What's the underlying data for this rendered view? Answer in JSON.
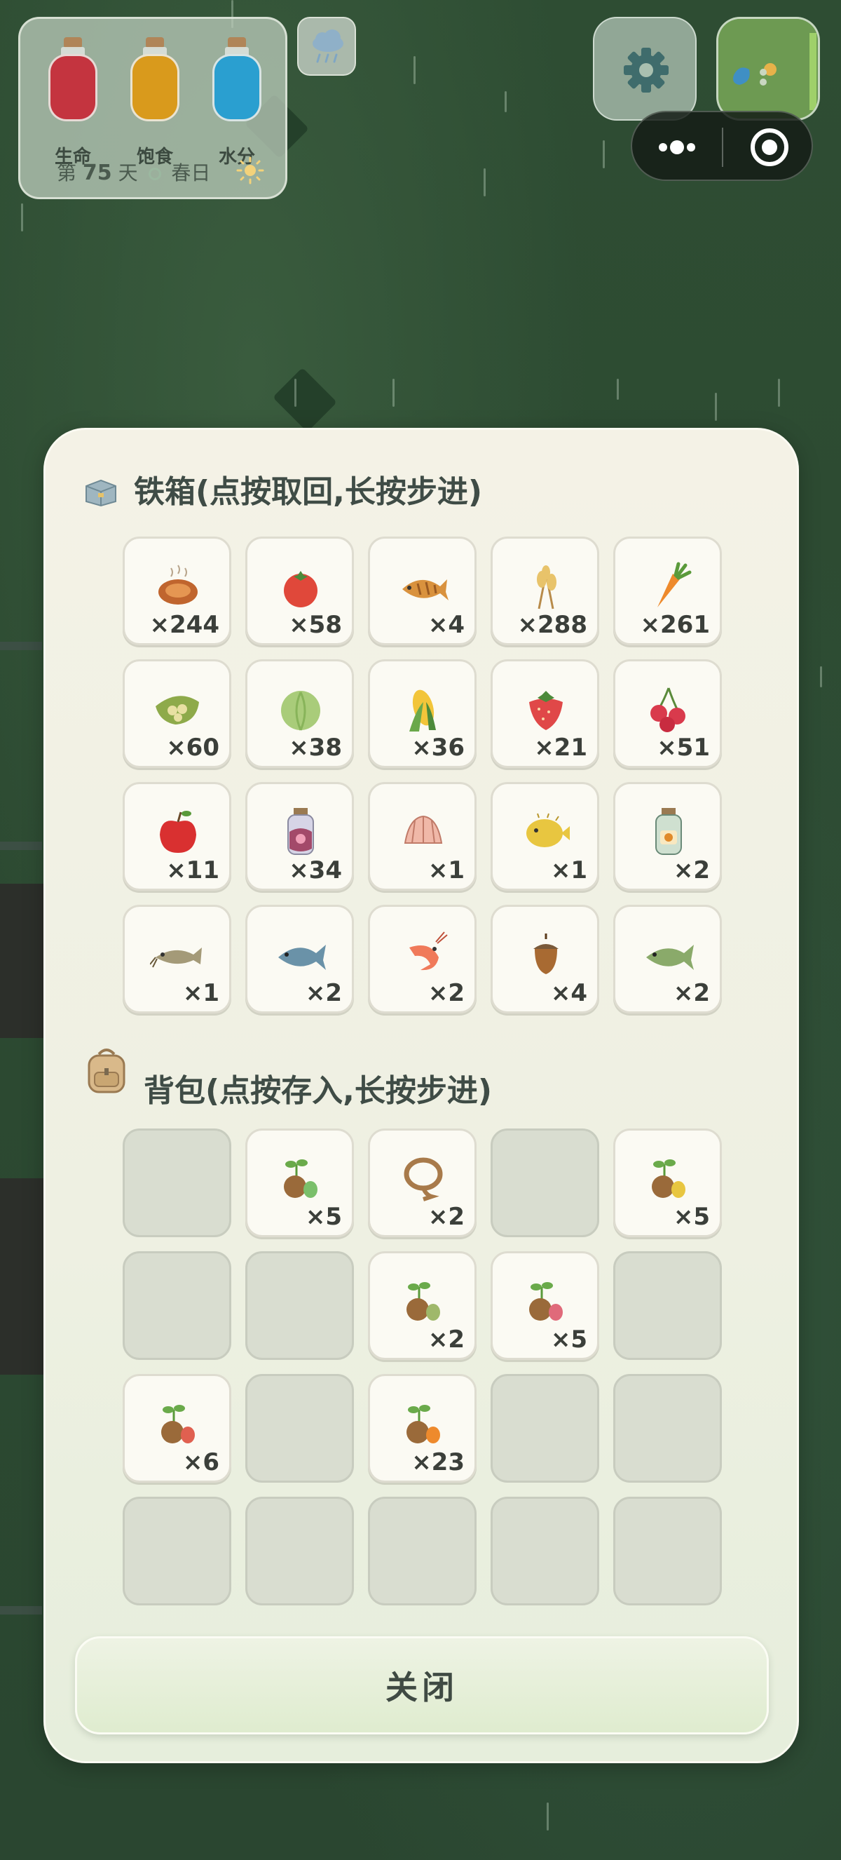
{
  "hud": {
    "stats": [
      {
        "label": "生命",
        "color": "#c4343f"
      },
      {
        "label": "饱食",
        "color": "#d99a1c"
      },
      {
        "label": "水分",
        "color": "#2a9fd0"
      }
    ],
    "day_prefix": "第",
    "day_number": "75",
    "day_suffix": "天",
    "season": "春日"
  },
  "chest": {
    "title": "铁箱(点按取回,长按步进)",
    "items": [
      {
        "icon": "roast-meat-icon",
        "count": "×244"
      },
      {
        "icon": "tomato-icon",
        "count": "×58"
      },
      {
        "icon": "grilled-fish-icon",
        "count": "×4"
      },
      {
        "icon": "wheat-icon",
        "count": "×288"
      },
      {
        "icon": "carrot-icon",
        "count": "×261"
      },
      {
        "icon": "bean-pod-icon",
        "count": "×60"
      },
      {
        "icon": "cabbage-icon",
        "count": "×38"
      },
      {
        "icon": "corn-icon",
        "count": "×36"
      },
      {
        "icon": "strawberry-icon",
        "count": "×21"
      },
      {
        "icon": "cherry-icon",
        "count": "×51"
      },
      {
        "icon": "apple-icon",
        "count": "×11"
      },
      {
        "icon": "berry-jam-jar-icon",
        "count": "×34"
      },
      {
        "icon": "shell-icon",
        "count": "×1"
      },
      {
        "icon": "pufferfish-icon",
        "count": "×1"
      },
      {
        "icon": "honey-jar-icon",
        "count": "×2"
      },
      {
        "icon": "catfish-icon",
        "count": "×1"
      },
      {
        "icon": "blue-fish-icon",
        "count": "×2"
      },
      {
        "icon": "shrimp-icon",
        "count": "×2"
      },
      {
        "icon": "acorn-icon",
        "count": "×4"
      },
      {
        "icon": "green-fish-icon",
        "count": "×2"
      }
    ]
  },
  "backpack": {
    "title": "背包(点按存入,长按步进)",
    "items": [
      {
        "icon": "",
        "count": ""
      },
      {
        "icon": "cabbage-seed-icon",
        "count": "×5"
      },
      {
        "icon": "rope-icon",
        "count": "×2"
      },
      {
        "icon": "",
        "count": ""
      },
      {
        "icon": "corn-seed-icon",
        "count": "×5"
      },
      {
        "icon": "",
        "count": ""
      },
      {
        "icon": "",
        "count": ""
      },
      {
        "icon": "bean-seed-icon",
        "count": "×2"
      },
      {
        "icon": "strawberry-seed-icon",
        "count": "×5"
      },
      {
        "icon": "",
        "count": ""
      },
      {
        "icon": "tomato-seed-icon",
        "count": "×6"
      },
      {
        "icon": "",
        "count": ""
      },
      {
        "icon": "carrot-seed-icon",
        "count": "×23"
      },
      {
        "icon": "",
        "count": ""
      },
      {
        "icon": "",
        "count": ""
      },
      {
        "icon": "",
        "count": ""
      },
      {
        "icon": "",
        "count": ""
      },
      {
        "icon": "",
        "count": ""
      },
      {
        "icon": "",
        "count": ""
      },
      {
        "icon": "",
        "count": ""
      }
    ]
  },
  "close_label": "关闭"
}
